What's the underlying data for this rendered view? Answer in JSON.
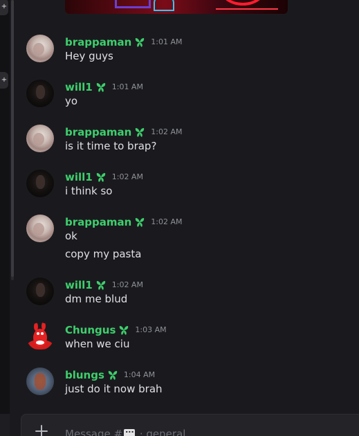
{
  "channel": {
    "placeholder_prefix": "Message #",
    "placeholder_suffix": "· general"
  },
  "rail": {
    "buttons": [
      "+",
      "+"
    ]
  },
  "messages": [
    {
      "author": "brappaman",
      "time": "1:01 AM",
      "lines": [
        "Hey guys"
      ],
      "avatar": "brappaman-avatar"
    },
    {
      "author": "will1",
      "time": "1:01 AM",
      "lines": [
        "yo"
      ],
      "avatar": "will1-avatar"
    },
    {
      "author": "brappaman",
      "time": "1:02 AM",
      "lines": [
        "is it time to brap?"
      ],
      "avatar": "brappaman-avatar"
    },
    {
      "author": "will1",
      "time": "1:02 AM",
      "lines": [
        "i think so"
      ],
      "avatar": "will1-avatar"
    },
    {
      "author": "brappaman",
      "time": "1:02 AM",
      "lines": [
        "ok",
        "copy my pasta"
      ],
      "avatar": "brappaman-avatar"
    },
    {
      "author": "will1",
      "time": "1:02 AM",
      "lines": [
        "dm me blud"
      ],
      "avatar": "will1-avatar"
    },
    {
      "author": "Chungus",
      "time": "1:03 AM",
      "lines": [
        "when we ciu"
      ],
      "avatar": "chungus-avatar"
    },
    {
      "author": "blungs",
      "time": "1:04 AM",
      "lines": [
        "just do it now brah"
      ],
      "avatar": "blungs-avatar"
    }
  ],
  "colors": {
    "username": "#3ecf6d",
    "background": "#1a1a1e",
    "role_icon": "#3ecf6d"
  },
  "icons": {
    "role": "leaf-role-icon",
    "composer_plus": "plus-icon",
    "channel_type": "chat-bubble-icon"
  }
}
